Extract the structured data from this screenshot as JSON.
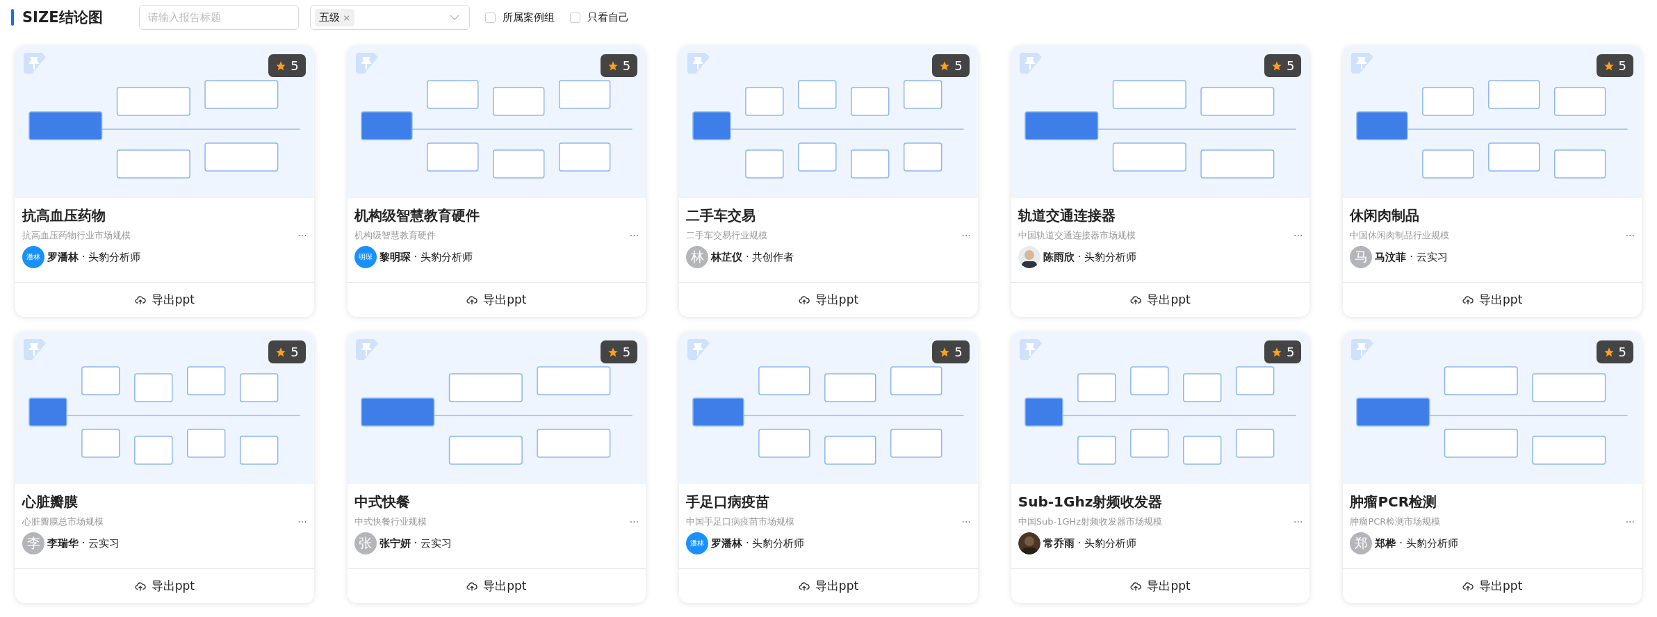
{
  "header": {
    "title": "SIZE结论图",
    "search": {
      "placeholder": "请输入报告标题"
    },
    "level_select": {
      "tags": [
        "五级"
      ],
      "remove_mark": "×"
    },
    "filters": [
      {
        "label": "所属案例组",
        "checked": false
      },
      {
        "label": "只看自己",
        "checked": false
      }
    ]
  },
  "cards": [
    {
      "title": "抗高血压药物",
      "subtitle": "抗高血压药物行业市场规模",
      "rating": "5",
      "author": "罗潘林",
      "role": "· 头豹分析师",
      "avatar": {
        "kind": "initials",
        "text": "潘林",
        "color": "#1890ff"
      },
      "export": "导出ppt",
      "more": "···"
    },
    {
      "title": "机构级智慧教育硬件",
      "subtitle": "机构级智慧教育硬件",
      "rating": "5",
      "author": "黎明琛",
      "role": "· 头豹分析师",
      "avatar": {
        "kind": "initials",
        "text": "明琛",
        "color": "#1890ff"
      },
      "export": "导出ppt",
      "more": "···"
    },
    {
      "title": "二手车交易",
      "subtitle": "二手车交易行业规模",
      "rating": "5",
      "author": "林芷仪",
      "role": "· 共创作者",
      "avatar": {
        "kind": "initials",
        "text": "林",
        "color": "#b4b5b9"
      },
      "export": "导出ppt",
      "more": "···"
    },
    {
      "title": "轨道交通连接器",
      "subtitle": "中国轨道交通连接器市场规模",
      "rating": "5",
      "author": "陈雨欣",
      "role": "· 头豹分析师",
      "export": "导出ppt",
      "more": "···"
    },
    {
      "title": "休闲肉制品",
      "subtitle": "中国休闲肉制品行业规模",
      "rating": "5",
      "author": "马汶菲",
      "role": "· 云实习",
      "avatar": {
        "kind": "initials",
        "text": "马",
        "color": "#b4b5b9"
      },
      "export": "导出ppt",
      "more": "···"
    },
    {
      "title": "心脏瓣膜",
      "subtitle": "心脏瓣膜总市场规模",
      "rating": "5",
      "author": "李瑞华",
      "role": "· 云实习",
      "avatar": {
        "kind": "initials",
        "text": "李",
        "color": "#b4b5b9"
      },
      "export": "导出ppt",
      "more": "···"
    },
    {
      "title": "中式快餐",
      "subtitle": "中式快餐行业规模",
      "rating": "5",
      "author": "张宁妍",
      "role": "· 云实习",
      "avatar": {
        "kind": "initials",
        "text": "张",
        "color": "#b4b5b9"
      },
      "export": "导出ppt",
      "more": "···"
    },
    {
      "title": "手足口病疫苗",
      "subtitle": "中国手足口病疫苗市场规模",
      "rating": "5",
      "author": "罗潘林",
      "role": "· 头豹分析师",
      "avatar": {
        "kind": "initials",
        "text": "潘林",
        "color": "#1890ff"
      },
      "export": "导出ppt",
      "more": "···"
    },
    {
      "title": "Sub-1Ghz射频收发器",
      "subtitle": "中国Sub-1GHz射频收发器市场规模",
      "rating": "5",
      "author": "常乔雨",
      "role": "· 头豹分析师",
      "export": "导出ppt",
      "more": "···"
    },
    {
      "title": "肿瘤PCR检测",
      "subtitle": "肿瘤PCR检测市场规模",
      "rating": "5",
      "author": "郑桦",
      "role": "· 头豹分析师",
      "avatar": {
        "kind": "initials",
        "text": "郑",
        "color": "#b4b5b9"
      },
      "export": "导出ppt",
      "more": "···"
    }
  ]
}
